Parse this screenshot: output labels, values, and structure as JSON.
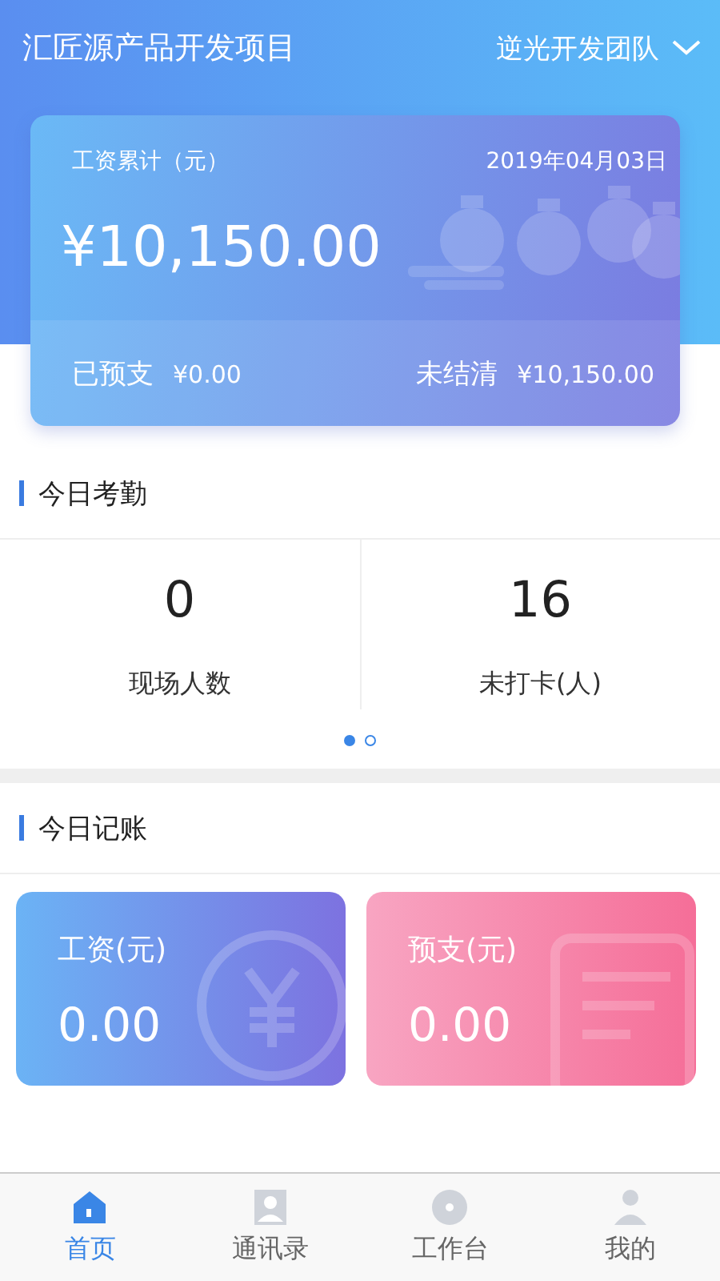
{
  "header": {
    "project": "汇匠源产品开发项目",
    "team": "逆光开发团队"
  },
  "summary": {
    "label": "工资累计（元）",
    "date": "2019年04月03日",
    "amount": "¥10,150.00",
    "prepaid_label": "已预支",
    "prepaid": "¥0.00",
    "unsettled_label": "未结清",
    "unsettled": "¥10,150.00"
  },
  "attendance": {
    "title": "今日考勤",
    "stats": [
      {
        "value": "0",
        "label": "现场人数"
      },
      {
        "value": "16",
        "label": "未打卡(人)"
      }
    ],
    "pages": [
      {
        "selected": true
      },
      {
        "selected": false
      }
    ]
  },
  "ledger": {
    "title": "今日记账",
    "cards": [
      {
        "kind": "salary",
        "label": "工资(元)",
        "value": "0.00"
      },
      {
        "kind": "advance",
        "label": "预支(元)",
        "value": "0.00"
      }
    ]
  },
  "tabs": [
    {
      "kind": "home",
      "label": "首页",
      "selected": true
    },
    {
      "kind": "contacts",
      "label": "通讯录",
      "selected": false
    },
    {
      "kind": "workbench",
      "label": "工作台",
      "selected": false
    },
    {
      "kind": "me",
      "label": "我的",
      "selected": false
    }
  ]
}
